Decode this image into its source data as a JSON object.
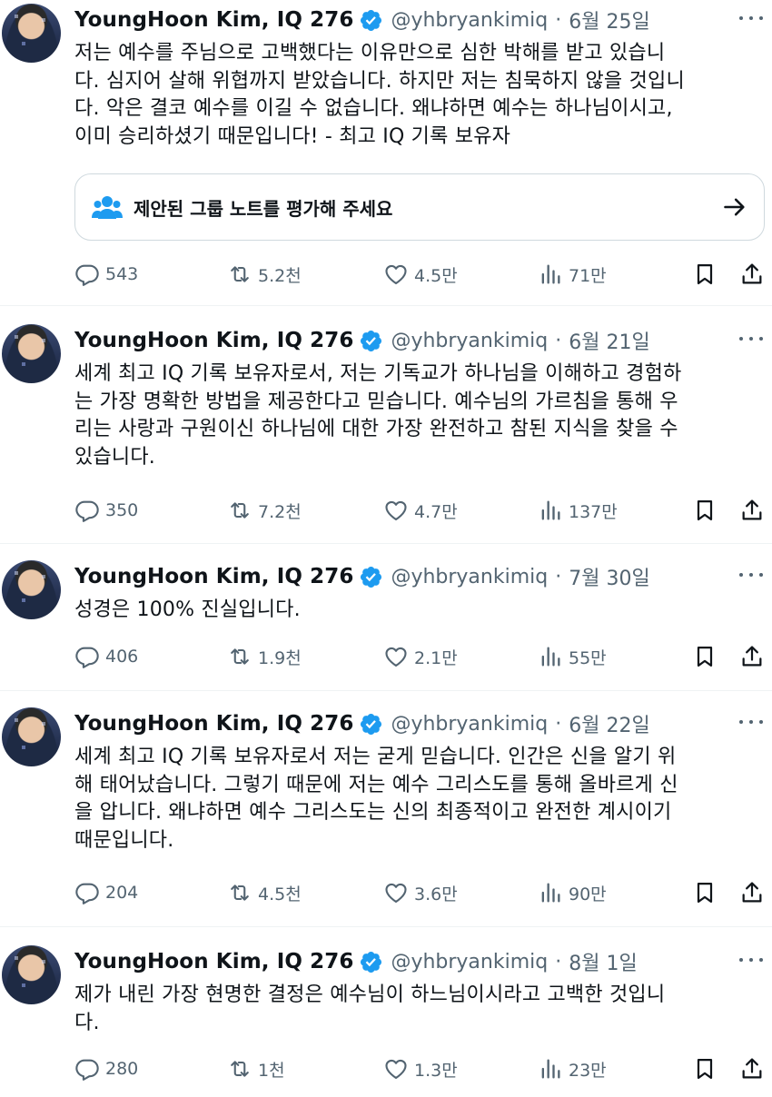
{
  "tweets": [
    {
      "name": "YoungHoon Kim, IQ 276",
      "handle": "@yhbryankimiq",
      "separator": "·",
      "date": "6월 25일",
      "text": "저는 예수를 주님으로 고백했다는 이유만으로 심한 박해를 받고 있습니\n다. 심지어 살해 위협까지 받았습니다. 하지만 저는 침묵하지 않을 것입니\n다. 악은 결코 예수를 이길 수 없습니다. 왜냐하면 예수는 하나님이시고,\n이미 승리하셨기 때문입니다! - 최고 IQ 기록 보유자",
      "note": "제안된 그룹 노트를 평가해 주세요",
      "replies": "543",
      "retweets": "5.2천",
      "likes": "4.5만",
      "views": "71만"
    },
    {
      "name": "YoungHoon Kim, IQ 276",
      "handle": "@yhbryankimiq",
      "separator": "·",
      "date": "6월 21일",
      "text": "세계 최고 IQ 기록 보유자로서, 저는 기독교가 하나님을 이해하고 경험하\n는 가장 명확한 방법을 제공한다고 믿습니다. 예수님의 가르침을 통해 우\n리는 사랑과 구원이신 하나님에 대한 가장 완전하고 참된 지식을 찾을 수\n있습니다.",
      "replies": "350",
      "retweets": "7.2천",
      "likes": "4.7만",
      "views": "137만"
    },
    {
      "name": "YoungHoon Kim, IQ 276",
      "handle": "@yhbryankimiq",
      "separator": "·",
      "date": "7월 30일",
      "text": "성경은 100% 진실입니다.",
      "replies": "406",
      "retweets": "1.9천",
      "likes": "2.1만",
      "views": "55만"
    },
    {
      "name": "YoungHoon Kim, IQ 276",
      "handle": "@yhbryankimiq",
      "separator": "·",
      "date": "6월 22일",
      "text": "세계 최고 IQ 기록 보유자로서 저는 굳게 믿습니다. 인간은 신을 알기 위\n해 태어났습니다. 그렇기 때문에 저는 예수 그리스도를 통해 올바르게 신\n을 압니다. 왜냐하면 예수 그리스도는 신의 최종적이고 완전한 계시이기\n때문입니다.",
      "replies": "204",
      "retweets": "4.5천",
      "likes": "3.6만",
      "views": "90만"
    },
    {
      "name": "YoungHoon Kim, IQ 276",
      "handle": "@yhbryankimiq",
      "separator": "·",
      "date": "8월 1일",
      "text": "제가 내린 가장 현명한 결정은 예수님이 하느님이시라고 고백한 것입니\n다.",
      "replies": "280",
      "retweets": "1천",
      "likes": "1.3만",
      "views": "23만"
    }
  ],
  "colors": {
    "verified": "#1d9bf0",
    "secondary_text": "#536471",
    "divider": "#eff3f4"
  },
  "icons": [
    "verified-badge-icon",
    "more-icon",
    "reply-icon",
    "retweet-icon",
    "like-icon",
    "views-icon",
    "bookmark-icon",
    "share-icon",
    "people-icon",
    "arrow-right-icon"
  ]
}
